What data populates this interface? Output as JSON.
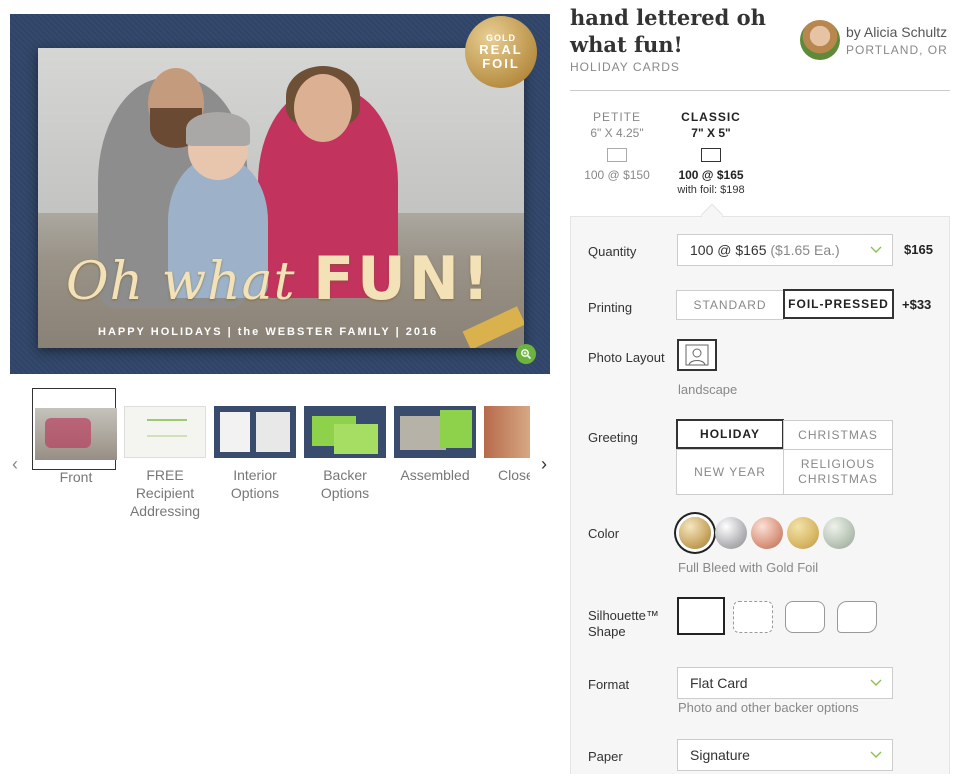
{
  "product": {
    "title": "hand lettered oh what fun!",
    "category": "HOLIDAY CARDS",
    "artist": {
      "byline": "by Alicia Schultz",
      "location": "PORTLAND, OR"
    }
  },
  "hero": {
    "badge": {
      "line1": "GOLD",
      "line2": "REAL",
      "line3": "FOIL"
    },
    "card_script": "Oh what",
    "card_script_bold": "FUN!",
    "card_line": "HAPPY HOLIDAYS | the WEBSTER FAMILY | 2016"
  },
  "thumbnails": [
    {
      "label": "Front"
    },
    {
      "label": "FREE Recipient Addressing"
    },
    {
      "label": "Interior Options"
    },
    {
      "label": "Backer Options"
    },
    {
      "label": "Assembled"
    },
    {
      "label": "Close"
    }
  ],
  "sizes": [
    {
      "name": "PETITE",
      "dims": "6\" X 4.25\"",
      "price": "100 @ $150",
      "foil": ""
    },
    {
      "name": "CLASSIC",
      "dims": "7\" X 5\"",
      "price": "100 @ $165",
      "foil": "with foil: $198"
    }
  ],
  "options": {
    "quantity": {
      "label": "Quantity",
      "value": "100 @ $165",
      "each": "($1.65 Ea.)",
      "price": "$165"
    },
    "printing": {
      "label": "Printing",
      "choices": [
        "STANDARD",
        "FOIL-PRESSED"
      ],
      "price": "+$33"
    },
    "photo_layout": {
      "label": "Photo Layout",
      "caption": "landscape"
    },
    "greeting": {
      "label": "Greeting",
      "choices": [
        "HOLIDAY",
        "CHRISTMAS",
        "NEW YEAR",
        "RELIGIOUS CHRISTMAS"
      ]
    },
    "color": {
      "label": "Color",
      "caption": "Full Bleed with Gold Foil"
    },
    "shape": {
      "label": "Silhouette™ Shape"
    },
    "format": {
      "label": "Format",
      "value": "Flat Card",
      "help": "Photo and other backer options"
    },
    "paper": {
      "label": "Paper",
      "value": "Signature"
    }
  },
  "colors": {
    "accent_green": "#6db33f",
    "border": "#cccccc",
    "panel_bg": "#f6f6f6"
  }
}
